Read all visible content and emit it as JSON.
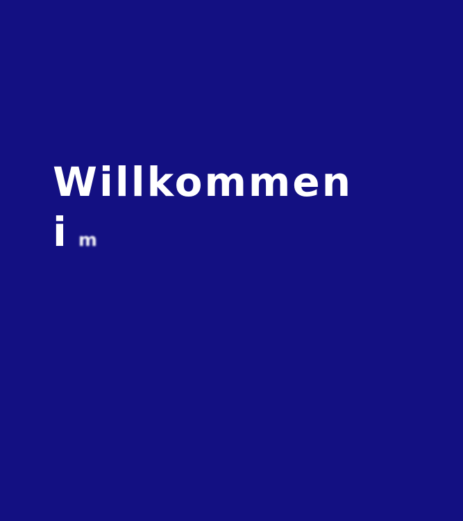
{
  "colors": {
    "background": "#131082",
    "text": "#ffffff"
  },
  "hero": {
    "line1": "Willkommen",
    "line2": "i",
    "typing_fragment": "m"
  }
}
